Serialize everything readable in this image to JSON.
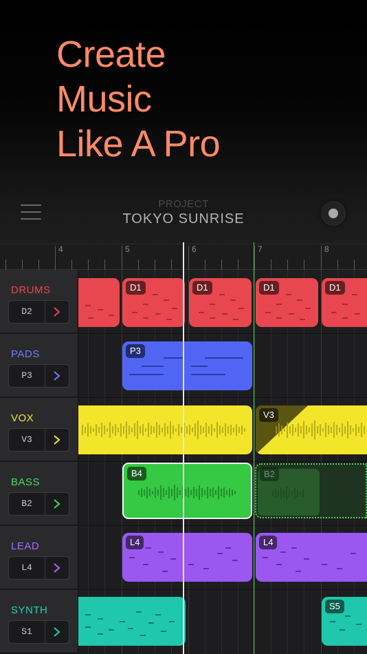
{
  "hero": {
    "lines": [
      "Create",
      "Music",
      "Like A Pro"
    ]
  },
  "topbar": {
    "project_label": "PROJECT",
    "project_name": "TOKYO SUNRISE",
    "menu_icon": "hamburger-icon",
    "record_icon": "record-icon"
  },
  "ruler": {
    "bars": [
      "4",
      "5",
      "6",
      "7",
      "8"
    ]
  },
  "colors": {
    "drums": "#e8474f",
    "pads": "#5165f5",
    "vox": "#f2e52a",
    "bass": "#36c943",
    "lead": "#9b58f0",
    "synth": "#1fc7ac",
    "accent": "#ff8a66",
    "marker": "#38d23a"
  },
  "tracks": [
    {
      "name": "DRUMS",
      "value": "D2",
      "color": "#e8474f"
    },
    {
      "name": "PADS",
      "value": "P3",
      "color": "#6f7dff"
    },
    {
      "name": "VOX",
      "value": "V3",
      "color": "#f2e52a"
    },
    {
      "name": "BASS",
      "value": "B2",
      "color": "#4fd85a"
    },
    {
      "name": "LEAD",
      "value": "L4",
      "color": "#a56cff"
    },
    {
      "name": "SYNTH",
      "value": "S1",
      "color": "#22d1b4"
    }
  ],
  "clips": {
    "drums": [
      "D1",
      "D1",
      "D1",
      "D1"
    ],
    "pads": [
      "P3"
    ],
    "vox": [
      "V3"
    ],
    "bass": [
      "B4",
      "B2"
    ],
    "lead": [
      "L4",
      "L4"
    ],
    "synth": [
      "S5"
    ]
  }
}
